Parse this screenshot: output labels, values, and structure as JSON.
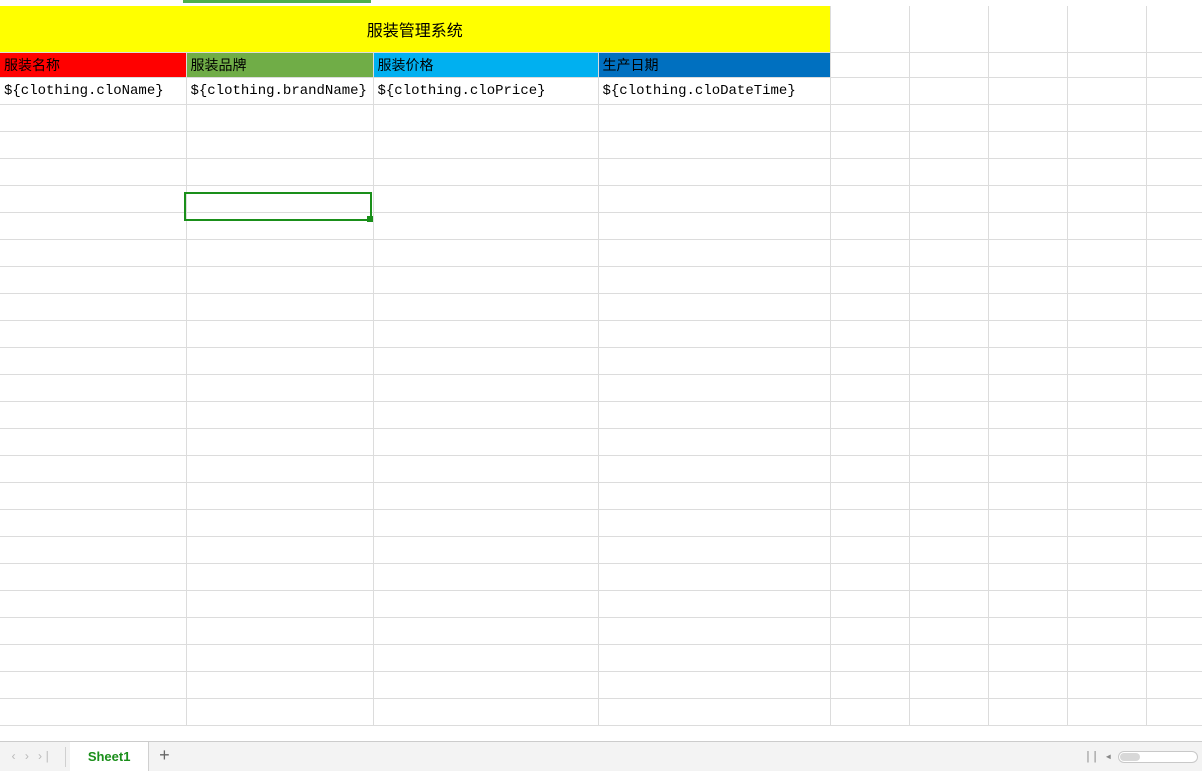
{
  "title_row": {
    "text": "服装管理系统"
  },
  "headers": {
    "col1": "服装名称",
    "col2": "服装品牌",
    "col3": "服装价格",
    "col4": "生产日期"
  },
  "data_row": {
    "col1": "${clothing.cloName}",
    "col2": "${clothing.brandName}",
    "col3": "${clothing.cloPrice}",
    "col4": "${clothing.cloDateTime}"
  },
  "tabs": {
    "active": "Sheet1"
  },
  "nav": {
    "prev": "‹",
    "next": "›",
    "last": "›|",
    "add": "+",
    "sep": "||",
    "tri": "◂"
  }
}
